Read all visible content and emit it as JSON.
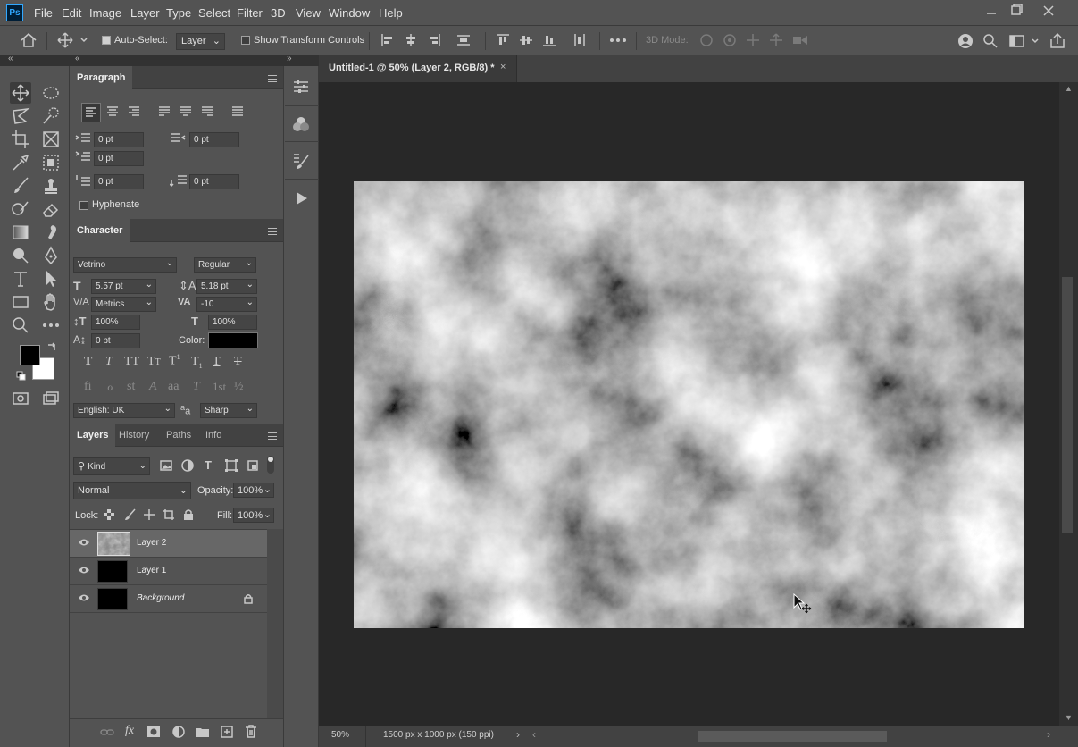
{
  "app": {
    "logo": "Ps"
  },
  "menu": [
    "File",
    "Edit",
    "Image",
    "Layer",
    "Type",
    "Select",
    "Filter",
    "3D",
    "View",
    "Window",
    "Help"
  ],
  "options": {
    "auto_select_label": "Auto-Select:",
    "auto_select_checked": true,
    "auto_select_target": "Layer",
    "transform_controls_label": "Show Transform Controls",
    "transform_controls_checked": false,
    "mode_3d_label": "3D Mode:"
  },
  "paragraph": {
    "tab": "Paragraph",
    "indent_left": "0 pt",
    "indent_right": "0 pt",
    "indent_first": "0 pt",
    "space_before": "0 pt",
    "space_after": "0 pt",
    "hyphenate_label": "Hyphenate"
  },
  "character": {
    "tab": "Character",
    "font_family": "Vetrino",
    "font_style": "Regular",
    "font_size": "5.57 pt",
    "leading": "5.18 pt",
    "kerning": "Metrics",
    "tracking": "-10",
    "vertical_scale": "100%",
    "horizontal_scale": "100%",
    "baseline_shift": "0 pt",
    "color_label": "Color:",
    "language": "English: UK",
    "antialias": "Sharp",
    "ot_glyphs": [
      "fi",
      "ℴ",
      "st",
      "A",
      "aa",
      "T",
      "1st",
      "½"
    ]
  },
  "layers_panel": {
    "tabs": [
      "Layers",
      "History",
      "Paths",
      "Info"
    ],
    "filter_kind": "Kind",
    "blend_mode": "Normal",
    "opacity_label": "Opacity:",
    "opacity": "100%",
    "lock_label": "Lock:",
    "fill_label": "Fill:",
    "fill": "100%",
    "layers": [
      {
        "name": "Layer 2",
        "selected": true,
        "thumb": "clouds"
      },
      {
        "name": "Layer 1",
        "selected": false,
        "thumb": "black"
      },
      {
        "name": "Background",
        "selected": false,
        "thumb": "black",
        "locked": true
      }
    ]
  },
  "document": {
    "tab_title": "Untitled-1 @ 50% (Layer 2, RGB/8) *",
    "zoom": "50%",
    "dimensions": "1500 px x 1000 px (150 ppi)"
  },
  "colors": {
    "foreground": "#000000",
    "background": "#ffffff",
    "text_color_swatch": "#000000",
    "panel_bg": "#535353",
    "workspace_bg": "#282828"
  }
}
